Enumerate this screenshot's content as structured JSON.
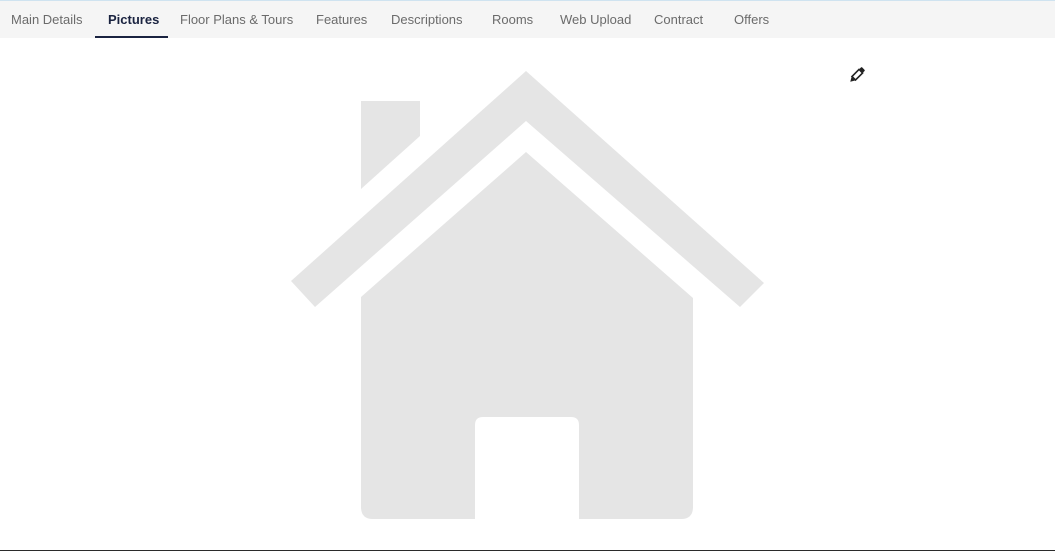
{
  "tabs": [
    {
      "label": "Main Details",
      "active": false
    },
    {
      "label": "Pictures",
      "active": true
    },
    {
      "label": "Floor Plans & Tours",
      "active": false
    },
    {
      "label": "Features",
      "active": false
    },
    {
      "label": "Descriptions",
      "active": false
    },
    {
      "label": "Rooms",
      "active": false
    },
    {
      "label": "Web Upload",
      "active": false
    },
    {
      "label": "Contract",
      "active": false
    },
    {
      "label": "Offers",
      "active": false
    }
  ],
  "icons": {
    "edit": "pencil-icon",
    "placeholder": "house-placeholder-icon"
  },
  "colors": {
    "accent": "#1a2340",
    "tab_text": "#6b6b6b",
    "tabbar_bg": "#f5f5f5",
    "placeholder_fill": "#e5e5e5"
  }
}
